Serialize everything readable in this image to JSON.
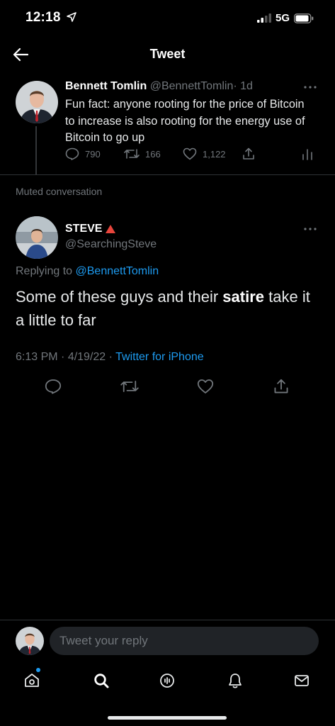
{
  "status_bar": {
    "time": "12:18",
    "network": "5G"
  },
  "header": {
    "title": "Tweet"
  },
  "parent_tweet": {
    "name": "Bennett Tomlin",
    "handle": "@BennettTomlin",
    "separator": "·",
    "age": "1d",
    "text": "Fun fact: anyone rooting for the price of Bitcoin to increase is also rooting for the energy use of Bitcoin to go up",
    "replies": "790",
    "retweets": "166",
    "likes": "1,122"
  },
  "muted_label": "Muted conversation",
  "focused_tweet": {
    "name": "STEVE",
    "handle": "@SearchingSteve",
    "replying_prefix": "Replying to",
    "replying_to": "@BennettTomlin",
    "text_before": "Some of these guys and their ",
    "text_bold": "satire",
    "text_after": " take it a little to far",
    "time": "6:13 PM",
    "date": "4/19/22",
    "meta_separator": " · ",
    "source": "Twitter for iPhone"
  },
  "reply_bar": {
    "placeholder": "Tweet your reply"
  },
  "tabs": [
    "home-icon",
    "search-icon",
    "spaces-icon",
    "notifications-icon",
    "messages-icon"
  ],
  "colors": {
    "accent": "#1d9bf0",
    "background": "#000000",
    "muted": "#71767b",
    "triangle": "#e0245e"
  }
}
